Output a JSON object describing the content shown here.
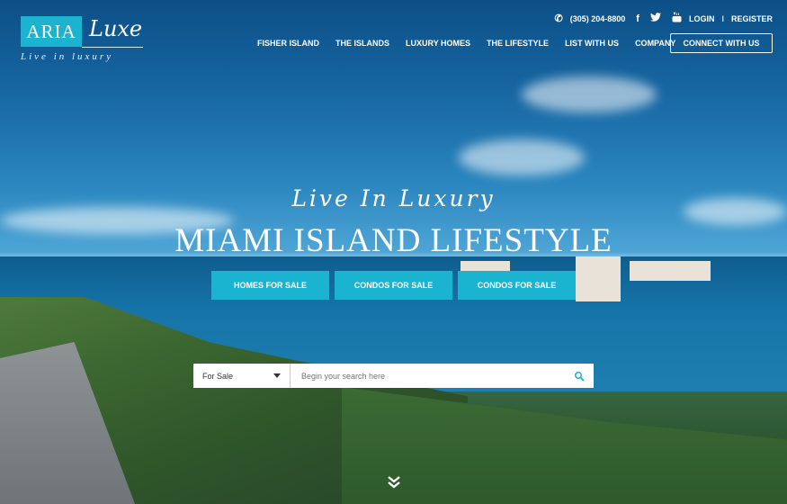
{
  "logo": {
    "brand": "ARIA",
    "luxe": "Luxe",
    "tagline": "Live in luxury"
  },
  "topbar": {
    "phone": "(305) 204-8800",
    "social_icons": [
      "facebook-icon",
      "twitter-icon",
      "youtube-icon"
    ],
    "login": "LOGIN",
    "separator": "I",
    "register": "REGISTER"
  },
  "nav": {
    "items": [
      "FISHER ISLAND",
      "THE ISLANDS",
      "LUXURY HOMES",
      "THE LIFESTYLE",
      "LIST WITH US",
      "COMPANY"
    ],
    "connect": "CONNECT  WITH US"
  },
  "hero": {
    "subtitle": "Live In Luxury",
    "title": "MIAMI ISLAND LIFESTYLE",
    "buttons": [
      "HOMES FOR SALE",
      "CONDOS FOR SALE",
      "CONDOS FOR SALE"
    ]
  },
  "search": {
    "select_value": "For Sale",
    "placeholder": "Begin your search here"
  },
  "colors": {
    "accent": "#1ab3d0"
  }
}
